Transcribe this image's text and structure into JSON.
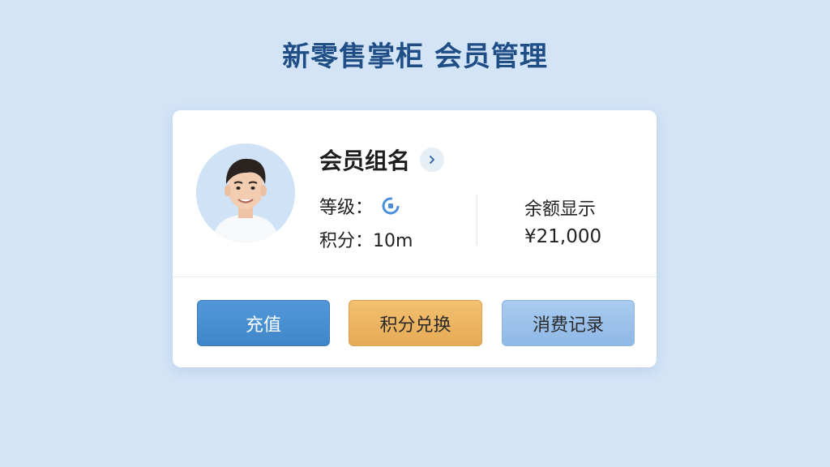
{
  "page": {
    "title": "新零售掌柜 会员管理"
  },
  "member": {
    "name": "会员组名",
    "level_label": "等级：",
    "points_label": "积分：10m",
    "balance_label": "余额显示",
    "balance_value": "¥21,000"
  },
  "actions": {
    "recharge": "充值",
    "redeem_points": "积分兑换",
    "purchase_history": "消费记录"
  },
  "icons": {
    "avatar": "avatar-photo",
    "name_action": "chevron-right-icon",
    "level": "level-badge-icon"
  },
  "colors": {
    "background": "#d3e4f7",
    "title": "#1f4e86",
    "recharge_button": "#4a90d4",
    "redeem_button": "#eeb663",
    "history_button": "#9ec3ec"
  }
}
